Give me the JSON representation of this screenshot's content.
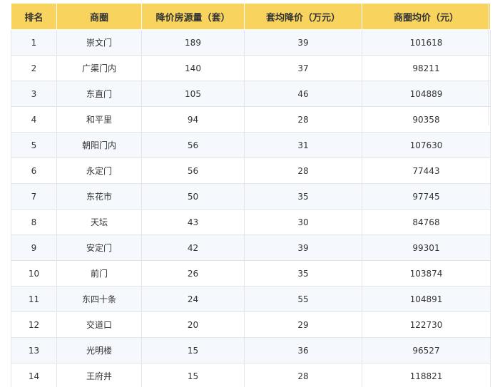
{
  "table": {
    "headers": [
      "排名",
      "商圈",
      "降价房源量（套）",
      "套均降价（万元）",
      "商圈均价（元）"
    ],
    "rows": [
      [
        "1",
        "崇文门",
        "189",
        "39",
        "101618"
      ],
      [
        "2",
        "广渠门内",
        "140",
        "37",
        "98211"
      ],
      [
        "3",
        "东直门",
        "105",
        "46",
        "104889"
      ],
      [
        "4",
        "和平里",
        "94",
        "28",
        "90358"
      ],
      [
        "5",
        "朝阳门内",
        "56",
        "31",
        "107630"
      ],
      [
        "6",
        "永定门",
        "56",
        "28",
        "77443"
      ],
      [
        "7",
        "东花市",
        "50",
        "35",
        "97745"
      ],
      [
        "8",
        "天坛",
        "43",
        "30",
        "84768"
      ],
      [
        "9",
        "安定门",
        "42",
        "39",
        "99301"
      ],
      [
        "10",
        "前门",
        "26",
        "35",
        "103874"
      ],
      [
        "11",
        "东四十条",
        "24",
        "55",
        "104891"
      ],
      [
        "12",
        "交道口",
        "20",
        "29",
        "122730"
      ],
      [
        "13",
        "光明楼",
        "15",
        "36",
        "96527"
      ],
      [
        "14",
        "王府井",
        "15",
        "28",
        "118821"
      ]
    ]
  },
  "colors": {
    "header_bg": "#f8d35e",
    "row_alt_bg": "#f5f8fd",
    "row_bg": "#ffffff",
    "border": "#e4e4e4",
    "text": "#333333"
  }
}
